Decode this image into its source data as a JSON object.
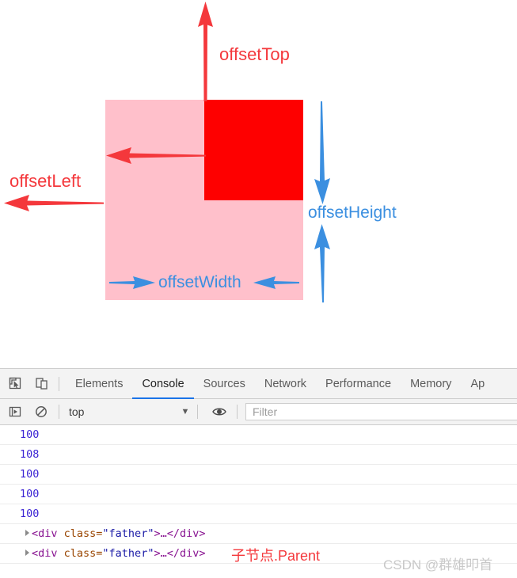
{
  "diagram": {
    "father_box": {
      "name": "father-element",
      "color": "#ffc0cb"
    },
    "son_box": {
      "name": "son-element",
      "color": "#fe0000"
    },
    "labels": {
      "offset_top": "offsetTop",
      "offset_left": "offsetLeft",
      "offset_width": "offsetWidth",
      "offset_height": "offsetHeight"
    },
    "colors": {
      "red_annotation": "#f4383c",
      "blue_annotation": "#3b8fe0"
    }
  },
  "devtools": {
    "icons": {
      "inspect": "inspect-element-icon",
      "device": "device-toolbar-icon",
      "execute": "execute-sidebar-icon",
      "clear": "clear-console-icon",
      "eye": "live-expression-eye-icon",
      "caret": "▼"
    },
    "tabs": [
      {
        "label": "Elements",
        "active": false
      },
      {
        "label": "Console",
        "active": true
      },
      {
        "label": "Sources",
        "active": false
      },
      {
        "label": "Network",
        "active": false
      },
      {
        "label": "Performance",
        "active": false
      },
      {
        "label": "Memory",
        "active": false
      },
      {
        "label": "Ap",
        "active": false
      }
    ],
    "filterbar": {
      "context": "top",
      "filter_placeholder": "Filter",
      "filter_value": ""
    },
    "console_rows": [
      {
        "type": "number",
        "value": "100"
      },
      {
        "type": "number",
        "value": "108"
      },
      {
        "type": "number",
        "value": "100"
      },
      {
        "type": "number",
        "value": "100"
      },
      {
        "type": "number",
        "value": "100"
      },
      {
        "type": "node",
        "open": "<div ",
        "attr": "class=",
        "val": "\"father\"",
        "close": ">…</div>"
      },
      {
        "type": "node",
        "open": "<div ",
        "attr": "class=",
        "val": "\"father\"",
        "close": ">…</div>"
      }
    ]
  },
  "annotations": {
    "child_node": "子节点.Parent",
    "watermark": "CSDN @群雄叩首"
  }
}
